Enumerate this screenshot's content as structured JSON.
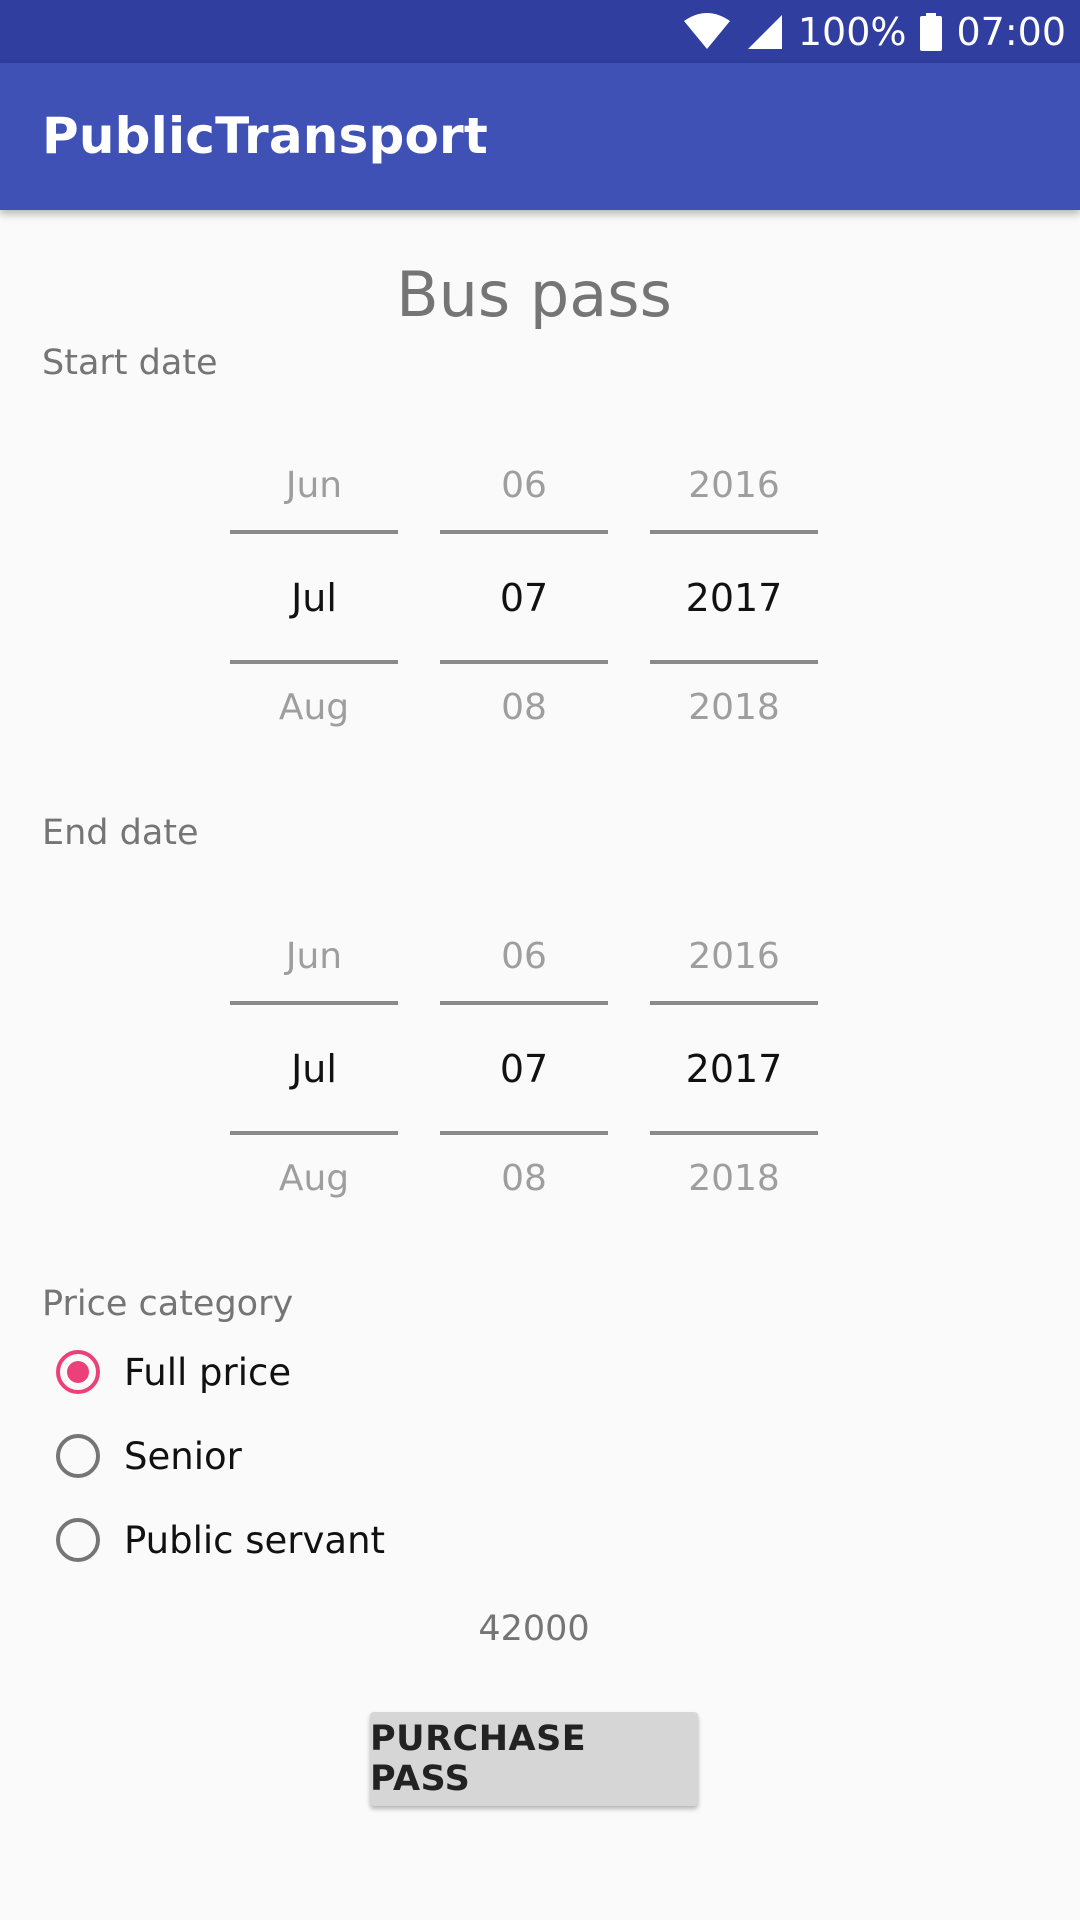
{
  "status_bar": {
    "battery": "100%",
    "time": "07:00",
    "icons": [
      "wifi-icon",
      "signal-icon",
      "battery-icon"
    ]
  },
  "app_bar": {
    "title": "PublicTransport"
  },
  "page": {
    "title": "Bus pass"
  },
  "start_date": {
    "label": "Start date",
    "month": {
      "prev": "Jun",
      "current": "Jul",
      "next": "Aug"
    },
    "day": {
      "prev": "06",
      "current": "07",
      "next": "08"
    },
    "year": {
      "prev": "2016",
      "current": "2017",
      "next": "2018"
    }
  },
  "end_date": {
    "label": "End date",
    "month": {
      "prev": "Jun",
      "current": "Jul",
      "next": "Aug"
    },
    "day": {
      "prev": "06",
      "current": "07",
      "next": "08"
    },
    "year": {
      "prev": "2016",
      "current": "2017",
      "next": "2018"
    }
  },
  "price_category": {
    "label": "Price category",
    "options": [
      {
        "label": "Full price",
        "checked": true
      },
      {
        "label": "Senior",
        "checked": false
      },
      {
        "label": "Public servant",
        "checked": false
      }
    ]
  },
  "price": {
    "value": "42000"
  },
  "purchase": {
    "label": "PURCHASE PASS"
  },
  "colors": {
    "status_bar": "#303f9f",
    "app_bar": "#3f51b5",
    "accent": "#ec407a",
    "background": "#fafafa"
  }
}
